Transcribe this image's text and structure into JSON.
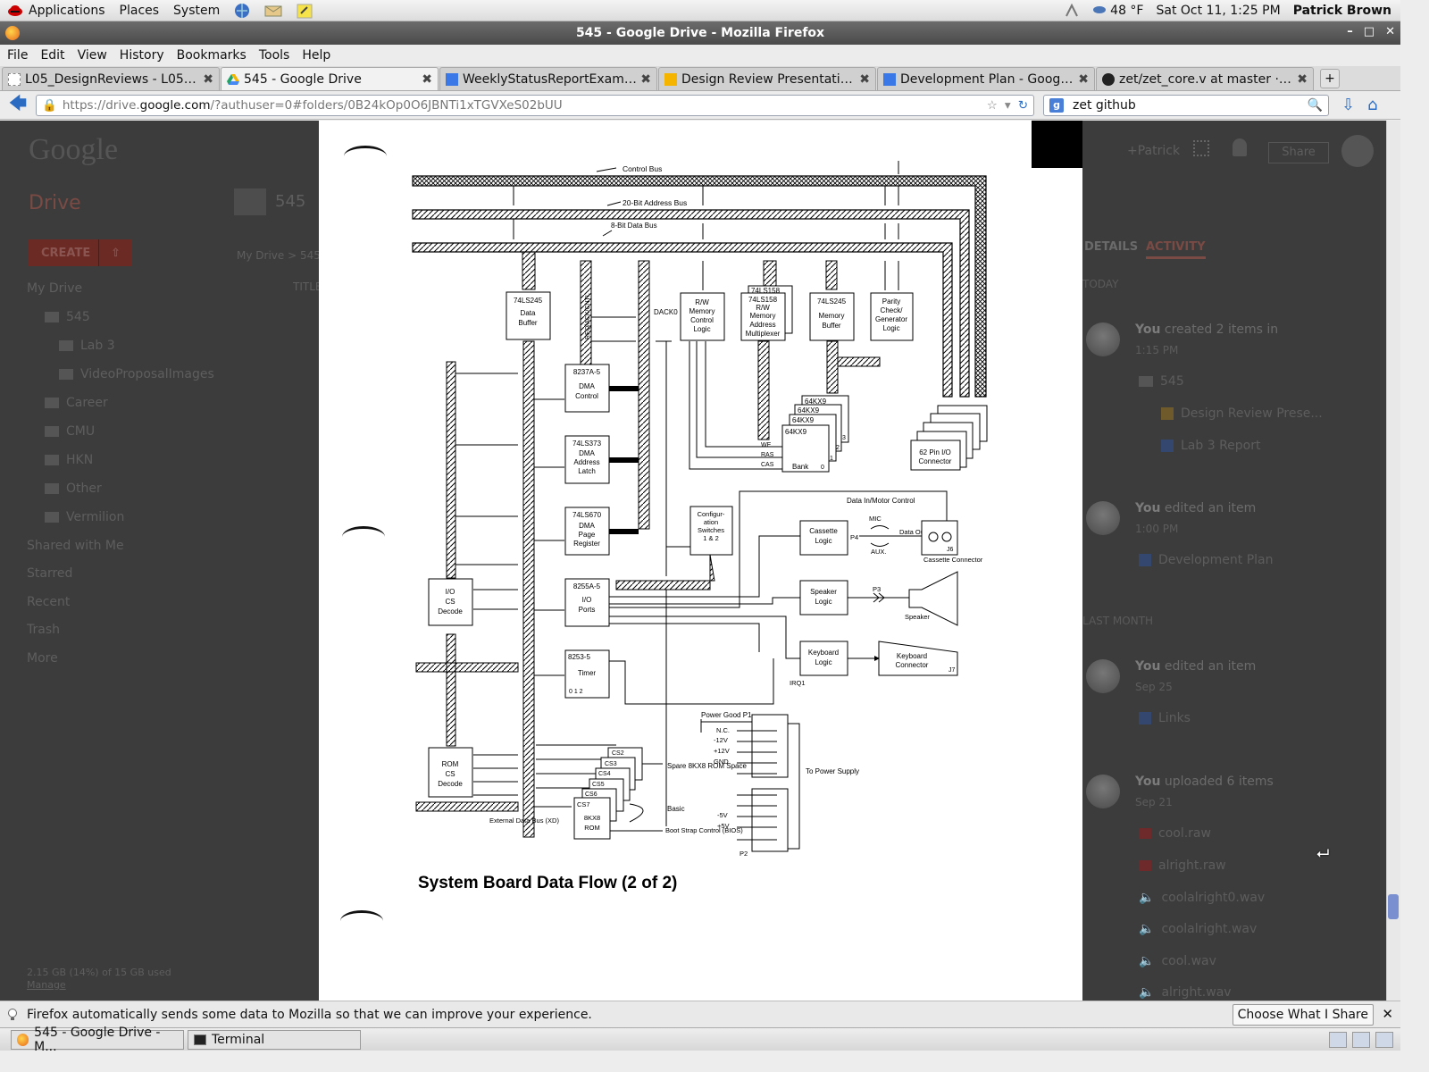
{
  "desktop": {
    "menus": [
      "Applications",
      "Places",
      "System"
    ],
    "weather": "48 °F",
    "datetime": "Sat Oct 11,  1:25 PM",
    "user": "Patrick Brown"
  },
  "window": {
    "title": "545 - Google Drive - Mozilla Firefox"
  },
  "menubar": [
    "File",
    "Edit",
    "View",
    "History",
    "Bookmarks",
    "Tools",
    "Help"
  ],
  "tabs": [
    {
      "label": "L05_DesignReviews - L05_D...",
      "icon": "page-icon"
    },
    {
      "label": "545 - Google Drive",
      "icon": "drive-icon"
    },
    {
      "label": "WeeklyStatusReportExampl...",
      "icon": "docs-icon"
    },
    {
      "label": "Design Review Presentation ...",
      "icon": "slides-icon"
    },
    {
      "label": "Development Plan - Google ...",
      "icon": "docs-icon"
    },
    {
      "label": "zet/zet_core.v at master · m...",
      "icon": "github-icon"
    }
  ],
  "navbar": {
    "url_prefix": "https://drive.",
    "url_domain": "google.com",
    "url_rest": "/?authuser=0#folders/0B24kOp0O6JBNTi1xTGVXeS02bUU",
    "search_value": "zet github"
  },
  "drive": {
    "logo": "Google",
    "title": "Drive",
    "create_label": "CREATE",
    "folder_title": "545",
    "breadcrumb": "My Drive  >  545",
    "column_title": "TITLE",
    "sidebar": [
      "My Drive",
      "545",
      "Lab 3",
      "VideoProposalImages",
      "Career",
      "CMU",
      "HKN",
      "Other",
      "Vermilion",
      "Shared with Me",
      "Starred",
      "Recent",
      "Trash",
      "More"
    ],
    "storage": "2.15 GB (14%) of 15 GB used",
    "manage": "Manage",
    "header_user": "+Patrick",
    "share_label": "Share"
  },
  "activity": {
    "tabs": [
      "DETAILS",
      "ACTIVITY"
    ],
    "sections": [
      "TODAY",
      "LAST MONTH"
    ],
    "entries": [
      {
        "actor": "You",
        "action": "created 2 items in",
        "time": "1:15 PM",
        "items": [
          "545",
          "Design Review Prese...",
          "Lab 3 Report"
        ]
      },
      {
        "actor": "You",
        "action": "edited an item",
        "time": "1:00 PM",
        "items": [
          "Development Plan"
        ]
      },
      {
        "actor": "You",
        "action": "edited an item",
        "time": "Sep 25",
        "items": [
          "Links"
        ]
      },
      {
        "actor": "You",
        "action": "uploaded 6 items",
        "time": "Sep 21",
        "items": [
          "cool.raw",
          "alright.raw",
          "coolalright0.wav",
          "coolalright.wav",
          "cool.wav",
          "alright.wav"
        ]
      }
    ]
  },
  "diagram": {
    "caption": "System Board Data Flow (2 of 2)",
    "buses": [
      "Control Bus",
      "20-Bit Address Bus",
      "8-Bit Data Bus"
    ],
    "chips": {
      "data_buffer": [
        "74LS245",
        "Data",
        "Buffer"
      ],
      "dma_control": [
        "8237A-5",
        "DMA",
        "Control"
      ],
      "dma_latch": [
        "74LS373",
        "DMA",
        "Address",
        "Latch"
      ],
      "dma_page": [
        "74LS670",
        "DMA",
        "Page",
        "Register"
      ],
      "io_ports": [
        "8255A-5",
        "I/O",
        "Ports"
      ],
      "timer": [
        "8253-5",
        "Timer"
      ],
      "timer_ch": "0    1    2",
      "io_cs": [
        "I/O",
        "CS",
        "Decode"
      ],
      "rom_cs": [
        "ROM",
        "CS",
        "Decode"
      ],
      "rw_mem": [
        "R/W",
        "Memory",
        "Control",
        "Logic"
      ],
      "mem_mux": [
        "74LS158",
        "74LS158",
        "R/W",
        "Memory",
        "Address",
        "Multiplexer"
      ],
      "mem_buf": [
        "74LS245",
        "Memory",
        "Buffer"
      ],
      "parity": [
        "Parity",
        "Check/",
        "Generator",
        "Logic"
      ],
      "config": [
        "Configur-",
        "ation",
        "Switches",
        "1 & 2"
      ],
      "cassette": [
        "Cassette",
        "Logic"
      ],
      "speaker": [
        "Speaker",
        "Logic"
      ],
      "keyboard": [
        "Keyboard",
        "Logic"
      ],
      "kbd_conn": [
        "Keyboard",
        "Connector"
      ],
      "io_conn": [
        "62 Pin I/O",
        "Connector"
      ],
      "rom": [
        "CS7",
        "8KX8",
        "ROM"
      ],
      "rom_stack": [
        "CS2",
        "CS3",
        "CS4",
        "CS5",
        "CS6"
      ],
      "ram": [
        "64KX9",
        "64KX9",
        "64KX9",
        "64KX9",
        "Bank",
        "0",
        "1",
        "2",
        "3"
      ]
    },
    "signals": {
      "req_ack": "REQ/ACK/CNTL",
      "dack0": "DACK0",
      "data_in_motor": "Data In/Motor Control",
      "mic": "MIC",
      "aux": "AUX.",
      "data_out": "Data Out",
      "j6": "J6",
      "cassette_conn": "Cassette Connector",
      "p4": "P4",
      "p3": "P3",
      "speaker": "Speaker",
      "irq1": "IRQ1",
      "j7": "J7",
      "we": "WE",
      "ras": "RAS",
      "cas": "CAS",
      "power_good": "Power Good P1",
      "nc": "N.C.",
      "m12": "-12V",
      "p12": "+12V",
      "gnd": "GND",
      "m5": "-5V",
      "p5": "+5V",
      "p2": "P2",
      "to_power": "To Power Supply",
      "spare": "Spare 8KX8 ROM Space",
      "basic": "Basic",
      "boot": "Boot Strap Control (BIOS)",
      "ext_bus": "External Data Bus (XD)"
    }
  },
  "notification": {
    "text": "Firefox automatically sends some data to Mozilla so that we can improve your experience.",
    "button": "Choose What I Share"
  },
  "taskbar": [
    {
      "label": "545 - Google Drive - M...",
      "icon": "firefox-icon"
    },
    {
      "label": "Terminal",
      "icon": "terminal-icon"
    }
  ]
}
